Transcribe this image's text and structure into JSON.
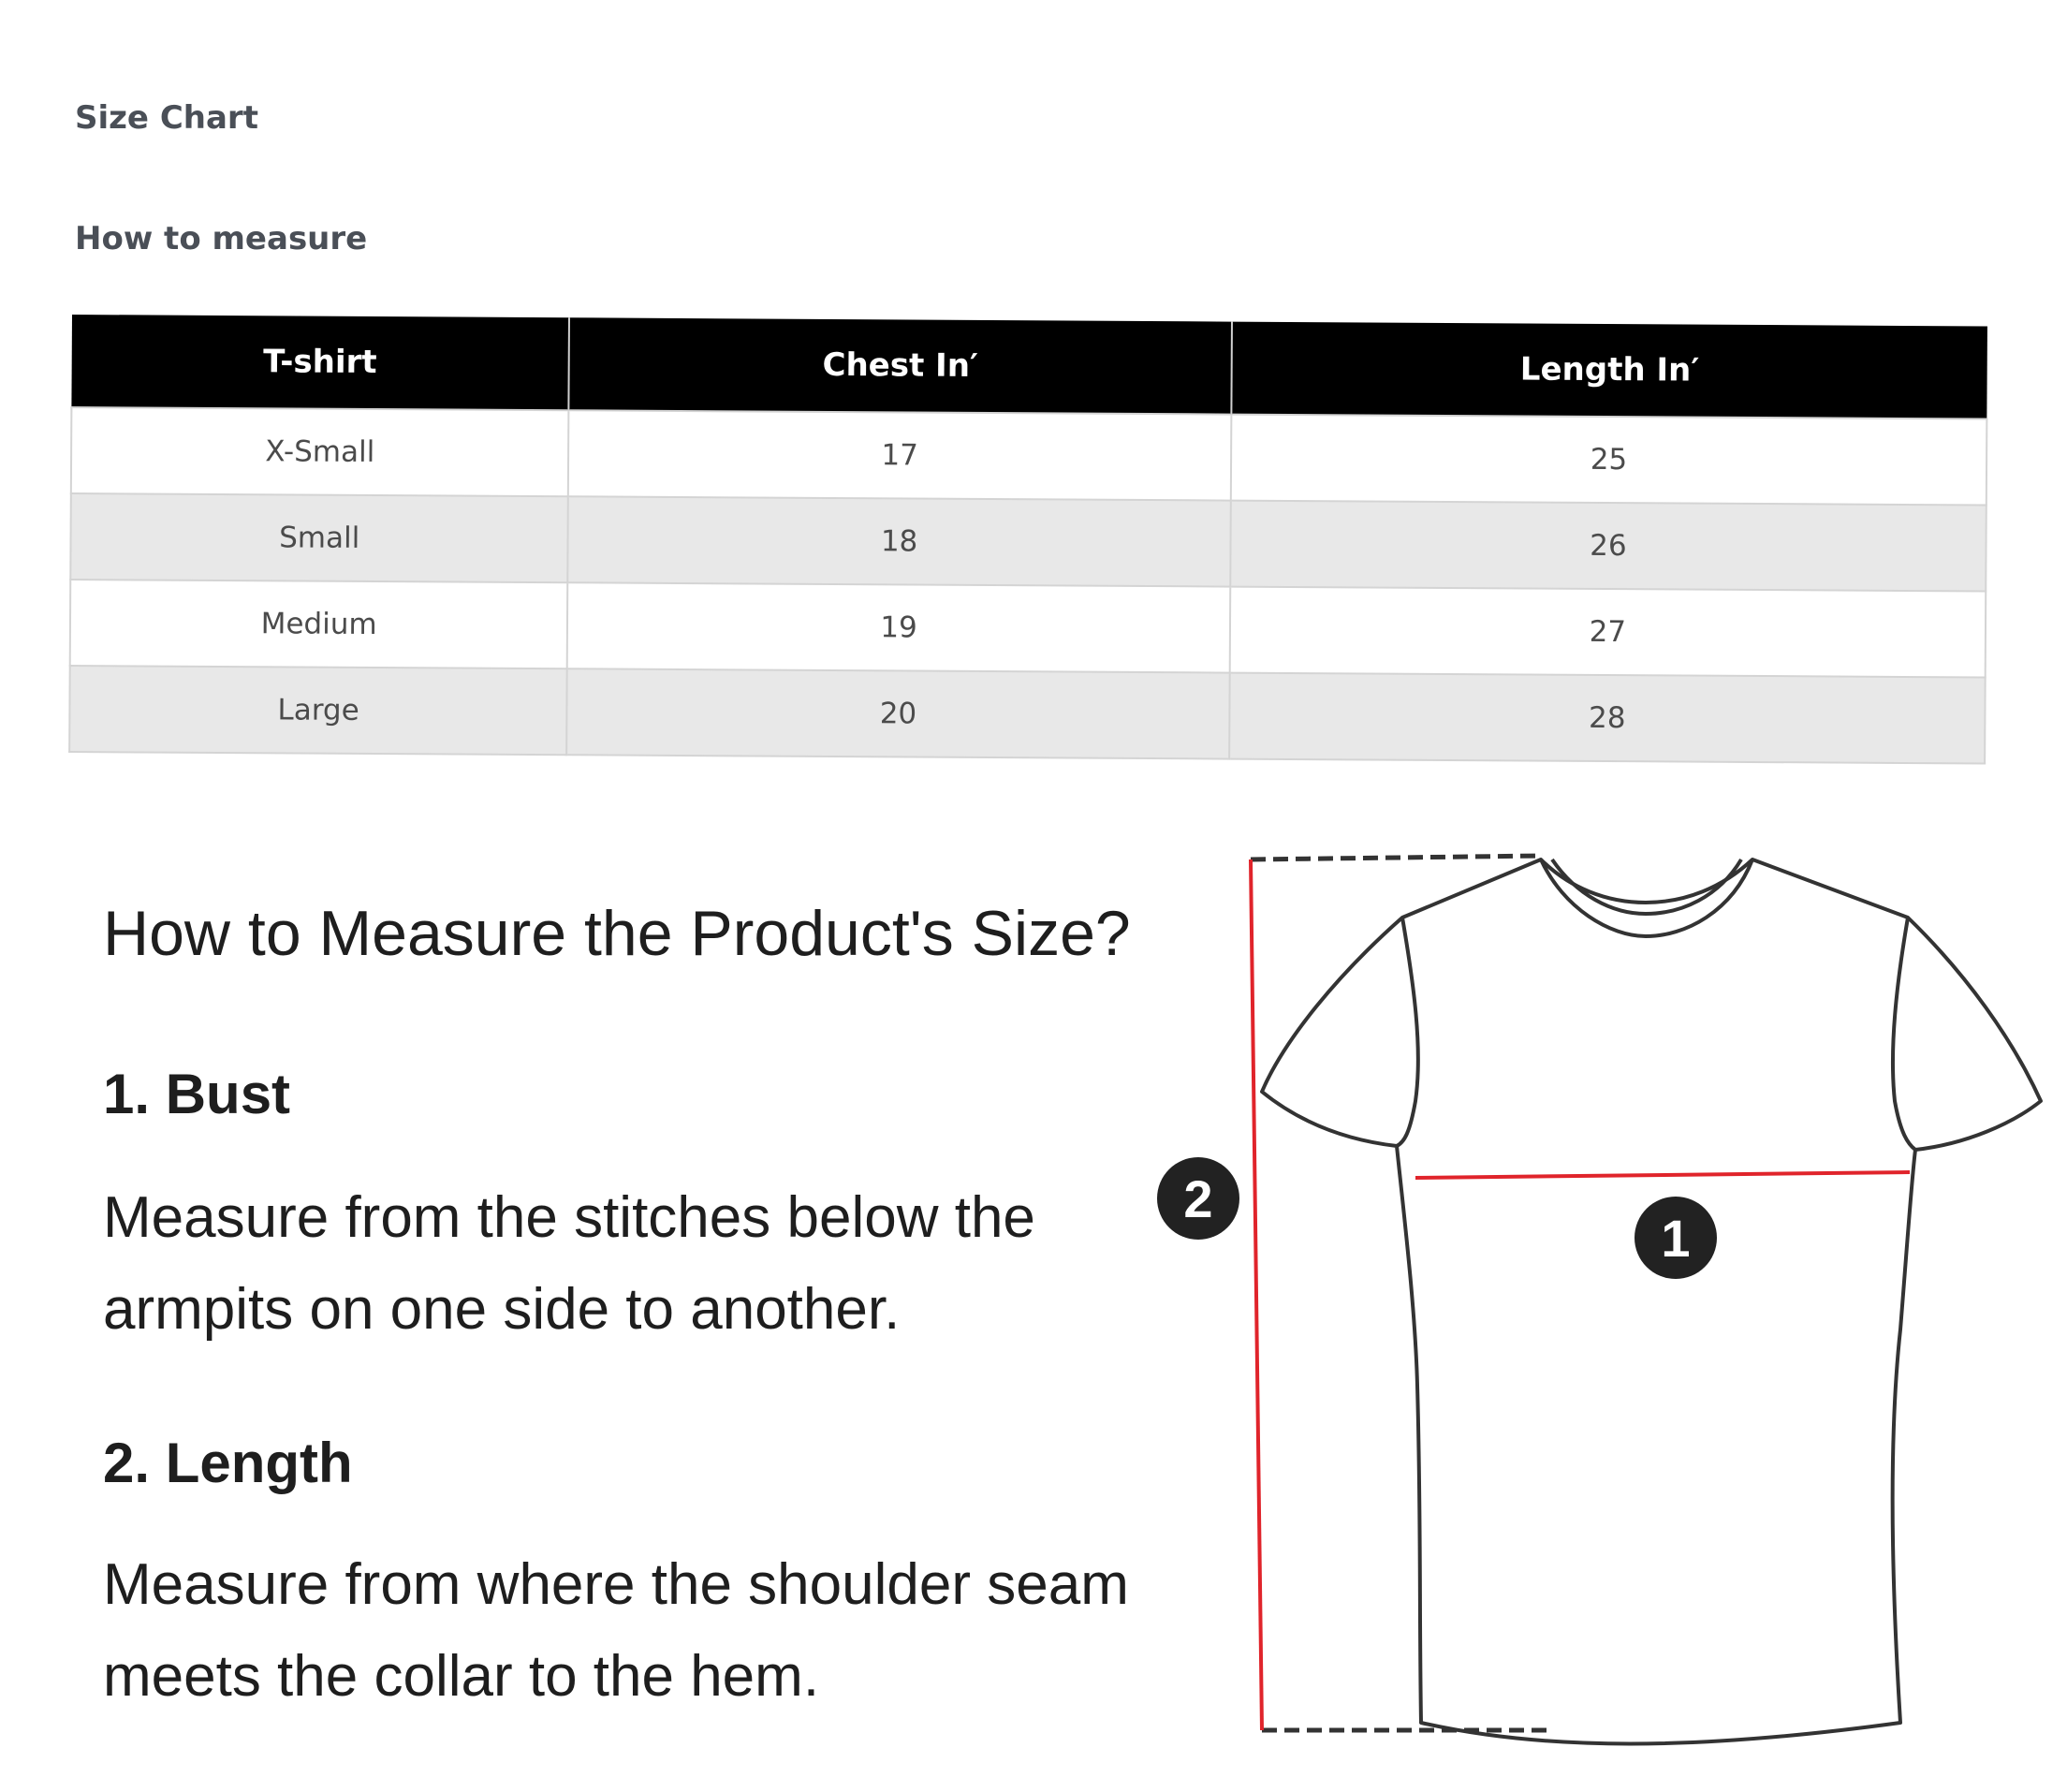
{
  "tabs": {
    "size_chart": "Size Chart",
    "how_to_measure": "How to measure"
  },
  "table": {
    "headers": [
      "T-shirt",
      "Chest In′",
      "Length In′"
    ],
    "rows": [
      [
        "X-Small",
        "17",
        "25"
      ],
      [
        "Small",
        "18",
        "26"
      ],
      [
        "Medium",
        "19",
        "27"
      ],
      [
        "Large",
        "20",
        "28"
      ]
    ]
  },
  "guide": {
    "title": "How to Measure the Product's Size?",
    "bust_heading": "1. Bust",
    "bust_text": "Measure from the stitches below the armpits on one side to another.",
    "length_heading": "2. Length",
    "length_text": "Measure from where the shoulder seam meets the collar to the hem."
  },
  "diagram": {
    "marker_1": "1",
    "marker_2": "2",
    "measure_line_color": "#e0242b",
    "outline_color": "#333333"
  }
}
